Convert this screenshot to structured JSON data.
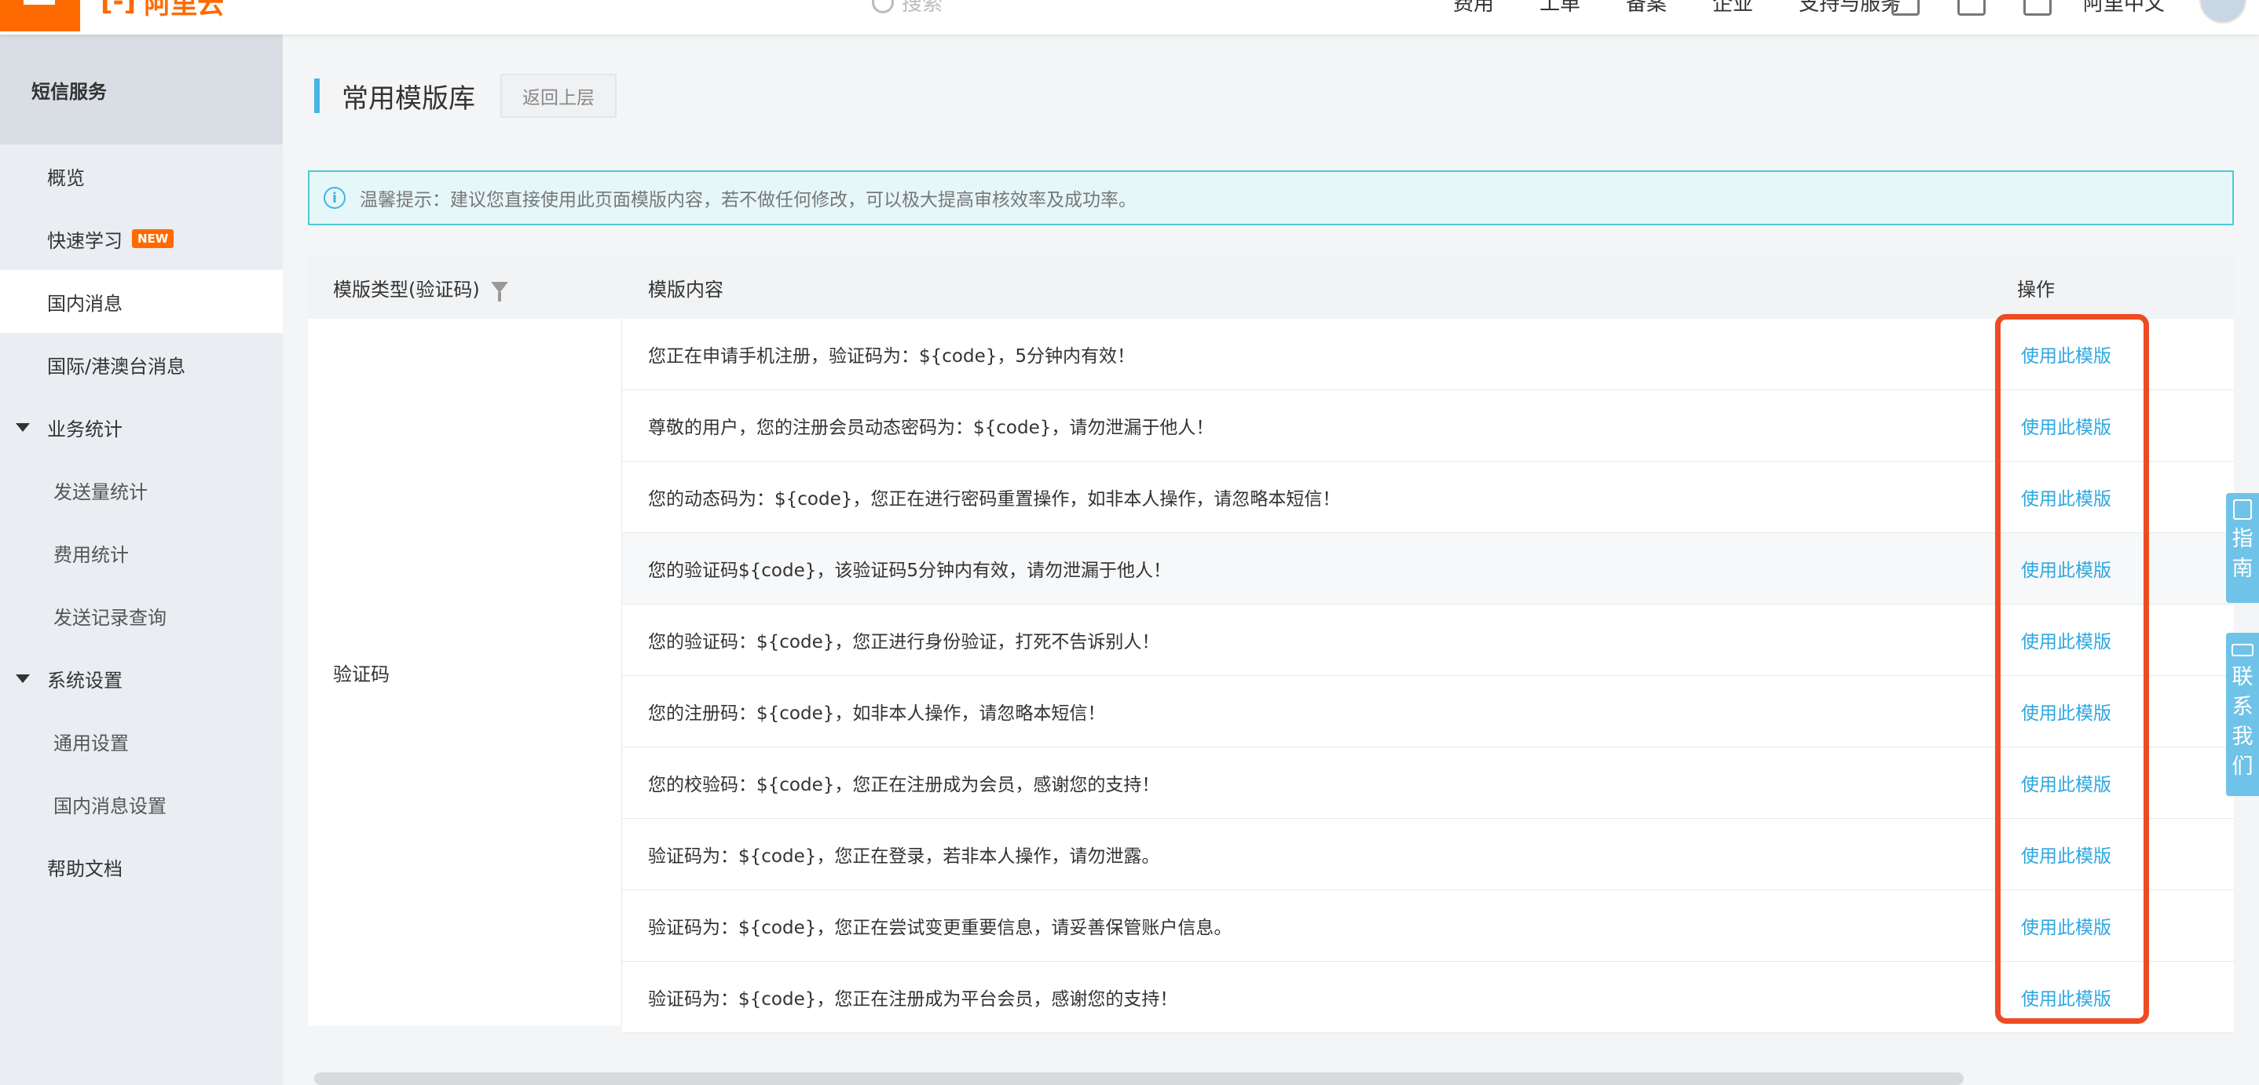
{
  "topbar": {
    "logo_text": "阿里云",
    "search_placeholder": "搜索",
    "nav": [
      "费用",
      "工单",
      "备案",
      "企业",
      "支持与服务"
    ],
    "user_name": "阿里中文"
  },
  "sidebar": {
    "title": "短信服务",
    "items": [
      {
        "label": "概览"
      },
      {
        "label": "快速学习",
        "badge": "NEW"
      },
      {
        "label": "国内消息"
      },
      {
        "label": "国际/港澳台消息"
      }
    ],
    "groups": [
      {
        "label": "业务统计",
        "children": [
          "发送量统计",
          "费用统计",
          "发送记录查询"
        ]
      },
      {
        "label": "系统设置",
        "children": [
          "通用设置",
          "国内消息设置"
        ]
      }
    ],
    "help": "帮助文档"
  },
  "page": {
    "title": "常用模版库",
    "back_label": "返回上层",
    "notice": "温馨提示：建议您直接使用此页面模版内容，若不做任何修改，可以极大提高审核效率及成功率。"
  },
  "table": {
    "headers": {
      "type": "模版类型(验证码)",
      "content": "模版内容",
      "action": "操作"
    },
    "type_value": "验证码",
    "action_label": "使用此模版",
    "rows": [
      "您正在申请手机注册，验证码为：${code}，5分钟内有效！",
      "尊敬的用户，您的注册会员动态密码为：${code}，请勿泄漏于他人！",
      "您的动态码为：${code}，您正在进行密码重置操作，如非本人操作，请忽略本短信！",
      "您的验证码${code}，该验证码5分钟内有效，请勿泄漏于他人！",
      "您的验证码：${code}，您正进行身份验证，打死不告诉别人！",
      "您的注册码：${code}，如非本人操作，请忽略本短信！",
      "您的校验码：${code}，您正在注册成为会员，感谢您的支持！",
      "验证码为：${code}，您正在登录，若非本人操作，请勿泄露。",
      "验证码为：${code}，您正在尝试变更重要信息，请妥善保管账户信息。",
      "验证码为：${code}，您正在注册成为平台会员，感谢您的支持！"
    ]
  },
  "float_tabs": {
    "guide": [
      "指",
      "南"
    ],
    "contact": [
      "联",
      "系",
      "我",
      "们"
    ]
  },
  "colors": {
    "brand": "#ff6a00",
    "link": "#2ea7e0",
    "highlight": "#ee4b23",
    "accent": "#46b4e6"
  }
}
